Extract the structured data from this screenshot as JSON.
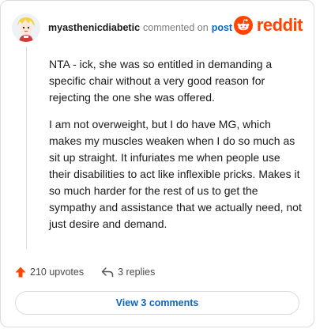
{
  "comment": {
    "username": "myasthenicdiabetic",
    "verb": "commented on",
    "post_link": "post",
    "paragraphs": [
      "NTA - ick, she was so entitled in demanding a specific chair without a very good reason for rejecting the one she was offered.",
      "I am not overweight, but I do have MG, which makes my muscles weaken when I do so much as sit up straight. It infuriates me when people use their disabilities to act like inflexible pricks. Makes it so much harder for the rest of us to get the sympathy and assistance that we actually need, not just desire and demand."
    ]
  },
  "brand": {
    "name": "reddit",
    "color": "#ff4500",
    "icon": "reddit-snoo-icon"
  },
  "actions": {
    "upvotes": "210 upvotes",
    "replies": "3 replies",
    "upvote_icon": "upvote-arrow-icon",
    "reply_icon": "reply-arrow-icon"
  },
  "view_comments": "View 3 comments",
  "colors": {
    "link": "#0a66c2",
    "upvote": "#ff4500"
  }
}
